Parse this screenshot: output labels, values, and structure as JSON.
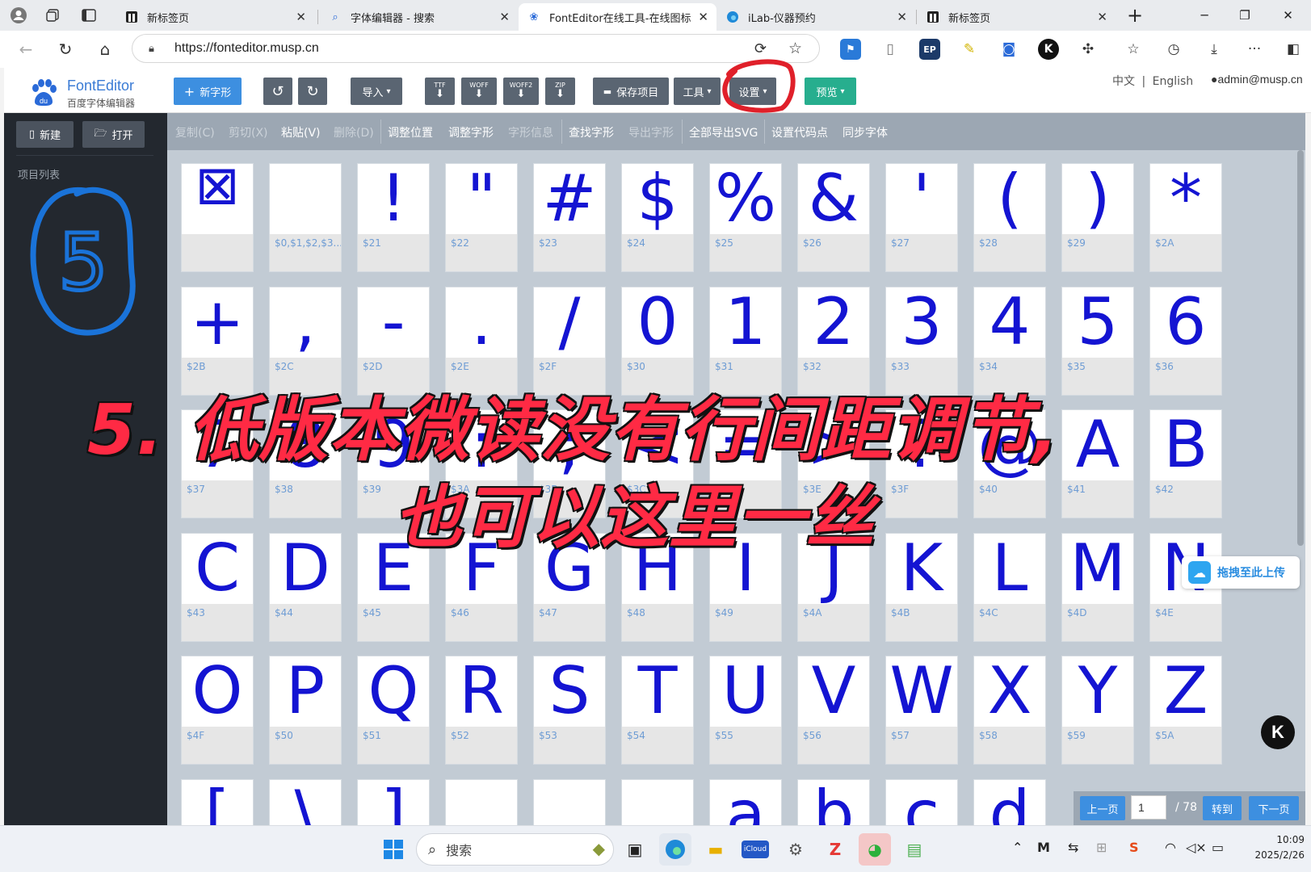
{
  "browser": {
    "tabs": [
      {
        "title": "新标签页",
        "icon": "browser-page-icon",
        "active": false
      },
      {
        "title": "字体编辑器 - 搜索",
        "icon": "search-icon",
        "active": false
      },
      {
        "title": "FontEditor在线工具-在线图标",
        "icon": "paw-icon",
        "active": true
      },
      {
        "title": "iLab-仪器预约",
        "icon": "edge-icon",
        "active": false
      },
      {
        "title": "新标签页",
        "icon": "browser-page-icon",
        "active": false
      }
    ],
    "new_tab": "+",
    "url": "https://fonteditor.musp.cn"
  },
  "app": {
    "brand": "FontEditor",
    "brand_sub": "百度字体编辑器",
    "toolbar": {
      "new_glyph": "新字形",
      "import": "导入",
      "export_ttf": "TTF",
      "export_woff": "WOFF",
      "export_woff2": "WOFF2",
      "export_zip": "ZIP",
      "save_project": "保存项目",
      "tools": "工具",
      "settings": "设置",
      "preview": "预览"
    },
    "lang_zh": "中文",
    "lang_sep": "|",
    "lang_en": "English",
    "admin": "admin@musp.cn"
  },
  "sidebar": {
    "new_label": "新建",
    "open_label": "打开",
    "project_list_label": "项目列表",
    "annotation_number": "5"
  },
  "edit_menu": [
    {
      "label": "复制(C)",
      "enabled": false
    },
    {
      "label": "剪切(X)",
      "enabled": false
    },
    {
      "label": "粘贴(V)",
      "enabled": true
    },
    {
      "label": "删除(D)",
      "enabled": false
    },
    {
      "label": "调整位置",
      "enabled": true
    },
    {
      "label": "调整字形",
      "enabled": true
    },
    {
      "label": "字形信息",
      "enabled": false
    },
    {
      "label": "查找字形",
      "enabled": true
    },
    {
      "label": "导出字形",
      "enabled": false
    },
    {
      "label": "全部导出SVG",
      "enabled": true
    },
    {
      "label": "设置代码点",
      "enabled": true
    },
    {
      "label": "同步字体",
      "enabled": true
    }
  ],
  "glyphs": [
    {
      "char": "⊠",
      "code": ""
    },
    {
      "char": "",
      "code": "$0,$1,$2,$3..."
    },
    {
      "char": "!",
      "code": "$21"
    },
    {
      "char": "\"",
      "code": "$22"
    },
    {
      "char": "#",
      "code": "$23"
    },
    {
      "char": "$",
      "code": "$24"
    },
    {
      "char": "%",
      "code": "$25"
    },
    {
      "char": "&",
      "code": "$26"
    },
    {
      "char": "'",
      "code": "$27"
    },
    {
      "char": "(",
      "code": "$28"
    },
    {
      "char": ")",
      "code": "$29"
    },
    {
      "char": "*",
      "code": "$2A"
    },
    {
      "char": "+",
      "code": "$2B"
    },
    {
      "char": ",",
      "code": "$2C"
    },
    {
      "char": "-",
      "code": "$2D"
    },
    {
      "char": ".",
      "code": "$2E"
    },
    {
      "char": "/",
      "code": "$2F"
    },
    {
      "char": "0",
      "code": "$30"
    },
    {
      "char": "1",
      "code": "$31"
    },
    {
      "char": "2",
      "code": "$32"
    },
    {
      "char": "3",
      "code": "$33"
    },
    {
      "char": "4",
      "code": "$34"
    },
    {
      "char": "5",
      "code": "$35"
    },
    {
      "char": "6",
      "code": "$36"
    },
    {
      "char": "7",
      "code": "$37"
    },
    {
      "char": "8",
      "code": "$38"
    },
    {
      "char": "9",
      "code": "$39"
    },
    {
      "char": ":",
      "code": "$3A"
    },
    {
      "char": ";",
      "code": "$3B"
    },
    {
      "char": "<",
      "code": "$3C"
    },
    {
      "char": "=",
      "code": "$3D"
    },
    {
      "char": ">",
      "code": "$3E"
    },
    {
      "char": "?",
      "code": "$3F"
    },
    {
      "char": "@",
      "code": "$40"
    },
    {
      "char": "A",
      "code": "$41"
    },
    {
      "char": "B",
      "code": "$42"
    },
    {
      "char": "C",
      "code": "$43"
    },
    {
      "char": "D",
      "code": "$44"
    },
    {
      "char": "E",
      "code": "$45"
    },
    {
      "char": "F",
      "code": "$46"
    },
    {
      "char": "G",
      "code": "$47"
    },
    {
      "char": "H",
      "code": "$48"
    },
    {
      "char": "I",
      "code": "$49"
    },
    {
      "char": "J",
      "code": "$4A"
    },
    {
      "char": "K",
      "code": "$4B"
    },
    {
      "char": "L",
      "code": "$4C"
    },
    {
      "char": "M",
      "code": "$4D"
    },
    {
      "char": "N",
      "code": "$4E"
    },
    {
      "char": "O",
      "code": "$4F"
    },
    {
      "char": "P",
      "code": "$50"
    },
    {
      "char": "Q",
      "code": "$51"
    },
    {
      "char": "R",
      "code": "$52"
    },
    {
      "char": "S",
      "code": "$53"
    },
    {
      "char": "T",
      "code": "$54"
    },
    {
      "char": "U",
      "code": "$55"
    },
    {
      "char": "V",
      "code": "$56"
    },
    {
      "char": "W",
      "code": "$57"
    },
    {
      "char": "X",
      "code": "$58"
    },
    {
      "char": "Y",
      "code": "$59"
    },
    {
      "char": "Z",
      "code": "$5A"
    },
    {
      "char": "[",
      "code": ""
    },
    {
      "char": "\\",
      "code": ""
    },
    {
      "char": "]",
      "code": ""
    },
    {
      "char": "",
      "code": ""
    },
    {
      "char": "",
      "code": ""
    },
    {
      "char": "",
      "code": ""
    },
    {
      "char": "a",
      "code": ""
    },
    {
      "char": "b",
      "code": ""
    },
    {
      "char": "c",
      "code": ""
    },
    {
      "char": "d",
      "code": ""
    }
  ],
  "pager": {
    "prev": "上一页",
    "current": "1",
    "total": "/ 78",
    "goto": "转到",
    "next": "下一页"
  },
  "upload_badge": "拖拽至此上传",
  "k_badge": "K",
  "caption": {
    "line1": "5. 低版本微读没有行间距调节,",
    "line2": "也可以这里一丝"
  },
  "taskbar": {
    "search_placeholder": "搜索",
    "icloud": "iCloud",
    "time": "10:09",
    "date": "2025/2/26"
  },
  "colors": {
    "glyph": "#1414d2",
    "caption": "#ff2a44",
    "annotation": "#1a73d9",
    "settings_circle": "#e0202a",
    "accent_blue": "#3d8fe0",
    "preview_green": "#27ae8e"
  }
}
